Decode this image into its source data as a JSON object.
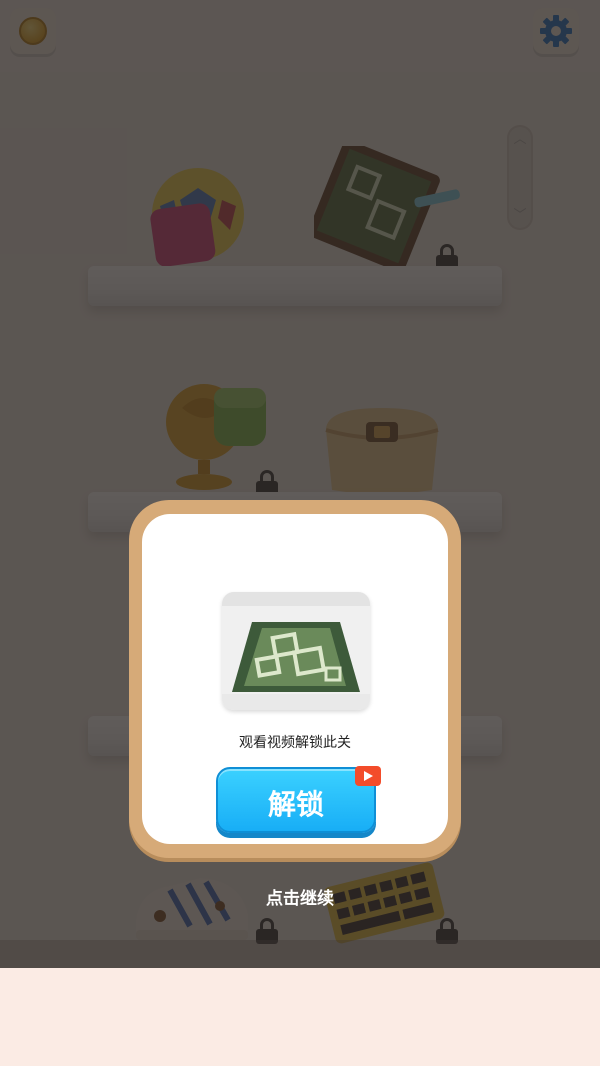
{
  "top_bar": {
    "coin_icon": "coin-icon",
    "settings_icon": "gear-icon",
    "accent_color": "#1c6fc9"
  },
  "shelves": [
    {
      "items": [
        {
          "name": "soccer-ball",
          "locked": false
        },
        {
          "name": "patterned-rug",
          "locked": true
        }
      ]
    },
    {
      "items": [
        {
          "name": "globe-sponge",
          "locked": true
        },
        {
          "name": "handbag",
          "locked": false
        }
      ]
    },
    {
      "items": []
    },
    {
      "items": [
        {
          "name": "sneaker",
          "locked": true
        },
        {
          "name": "keyboard",
          "locked": true
        }
      ]
    }
  ],
  "unlock_dialog": {
    "preview_icon": "rug-preview-image",
    "message": "观看视频解锁此关",
    "button_label": "解锁",
    "ad_badge_icon": "video-ad-icon",
    "button_color": "#21b8fa",
    "frame_color": "#d6aa78"
  },
  "continue_label": "点击继续"
}
